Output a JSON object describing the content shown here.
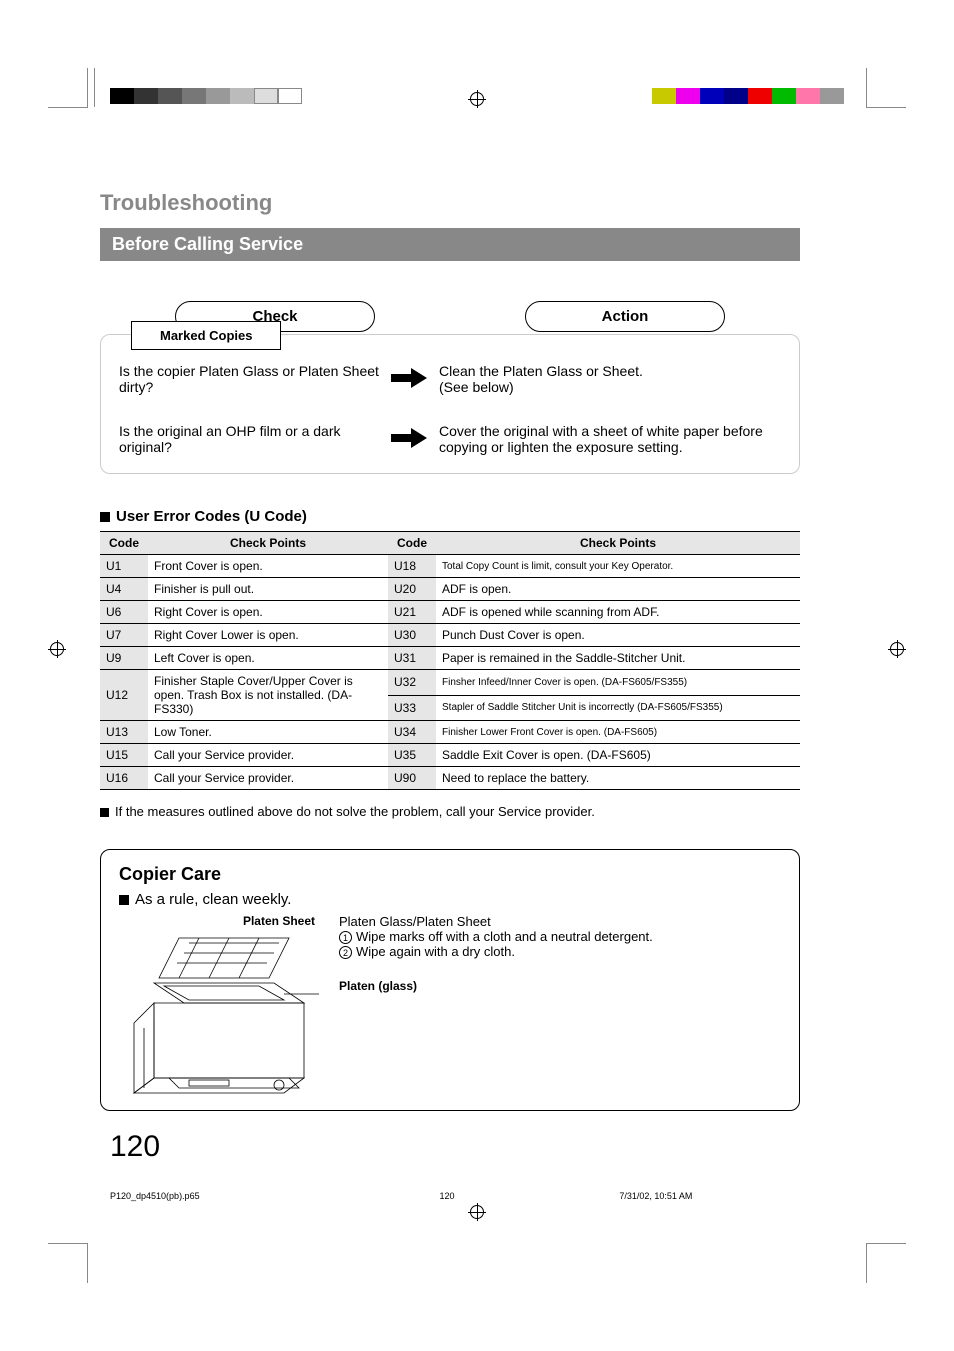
{
  "header": {
    "title": "Troubleshooting",
    "bar": "Before Calling Service"
  },
  "pills": {
    "check": "Check",
    "action": "Action"
  },
  "marked": {
    "label": "Marked Copies"
  },
  "qa": [
    {
      "q": "Is the copier Platen Glass or Platen Sheet dirty?",
      "a": "Clean the Platen Glass or Sheet.\n(See below)"
    },
    {
      "q": "Is the original an OHP film or a dark original?",
      "a": "Cover the original with a sheet of white paper before copying or lighten the exposure setting."
    }
  ],
  "codes": {
    "heading": "User Error Codes (U Code)",
    "th": {
      "code": "Code",
      "cp": "Check Points"
    },
    "left": [
      {
        "c": "U1",
        "p": "Front Cover is open."
      },
      {
        "c": "U4",
        "p": "Finisher is pull out."
      },
      {
        "c": "U6",
        "p": "Right Cover is open."
      },
      {
        "c": "U7",
        "p": "Right Cover Lower is open."
      },
      {
        "c": "U9",
        "p": "Left Cover is open."
      },
      {
        "c": "U12",
        "p": "Finisher Staple Cover/Upper Cover is open. Trash Box is not installed. (DA-FS330)",
        "rowspan": 2
      },
      {
        "c": "U13",
        "p": "Low Toner."
      },
      {
        "c": "U15",
        "p": "Call your Service provider."
      },
      {
        "c": "U16",
        "p": "Call your Service provider."
      }
    ],
    "right": [
      {
        "c": "U18",
        "p": "Total Copy Count is limit, consult your Key Operator.",
        "small": true
      },
      {
        "c": "U20",
        "p": "ADF is open."
      },
      {
        "c": "U21",
        "p": "ADF is opened while scanning from ADF."
      },
      {
        "c": "U30",
        "p": "Punch Dust Cover is open."
      },
      {
        "c": "U31",
        "p": "Paper is remained in the Saddle-Stitcher Unit."
      },
      {
        "c": "U32",
        "p": "Finsher Infeed/Inner Cover is open. (DA-FS605/FS355)",
        "small": true
      },
      {
        "c": "U33",
        "p": "Stapler of Saddle Stitcher Unit is incorrectly (DA-FS605/FS355)",
        "small": true
      },
      {
        "c": "U34",
        "p": "Finisher Lower Front Cover is open. (DA-FS605)",
        "small": true
      },
      {
        "c": "U35",
        "p": "Saddle Exit Cover is open. (DA-FS605)"
      },
      {
        "c": "U90",
        "p": "Need to replace the battery."
      }
    ]
  },
  "note": "If the measures outlined above do not solve the problem, call your Service provider.",
  "care": {
    "heading": "Copier Care",
    "rule": "As a rule, clean weekly.",
    "ps_label": "Platen Sheet",
    "pg_label": "Platen (glass)",
    "line1": "Platen Glass/Platen Sheet",
    "step1": "Wipe marks off with a cloth and a neutral detergent.",
    "step2": "Wipe again with a dry cloth."
  },
  "pagenum": "120",
  "footer": {
    "file": "P120_dp4510(pb).p65",
    "page": "120",
    "date": "7/31/02, 10:51 AM"
  }
}
